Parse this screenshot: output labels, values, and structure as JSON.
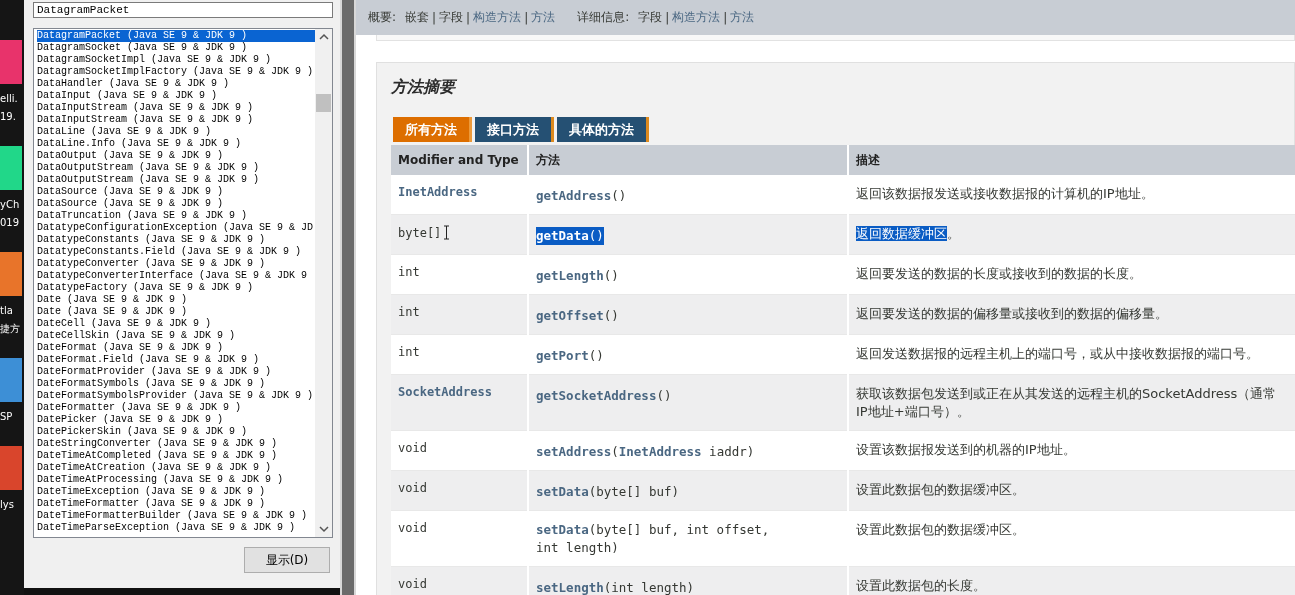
{
  "desktop_icons": [
    {
      "color": "#e8336b",
      "labels": [
        "elli.",
        "19."
      ]
    },
    {
      "color": "#21d789",
      "labels": [
        "yCh",
        "019"
      ]
    },
    {
      "color": "#e8742a",
      "labels": [
        "tla",
        "捷方"
      ]
    },
    {
      "color": "#3d8fd6",
      "labels": [
        "SP"
      ]
    },
    {
      "color": "#d9452c",
      "labels": [
        "lys"
      ]
    }
  ],
  "index_panel": {
    "search": {
      "value": "DatagramPacket"
    },
    "items": [
      {
        "text": "DatagramPacket (Java SE 9 & JDK 9 )",
        "selected": true
      },
      {
        "text": "DatagramSocket (Java SE 9 & JDK 9 )",
        "selected": false
      },
      {
        "text": "DatagramSocketImpl (Java SE 9 & JDK 9 )",
        "selected": false
      },
      {
        "text": "DatagramSocketImplFactory (Java SE 9 & JDK 9 )",
        "selected": false
      },
      {
        "text": "DataHandler (Java SE 9 & JDK 9 )",
        "selected": false
      },
      {
        "text": "DataInput (Java SE 9 & JDK 9 )",
        "selected": false
      },
      {
        "text": "DataInputStream (Java SE 9 & JDK 9 )",
        "selected": false
      },
      {
        "text": "DataInputStream (Java SE 9 & JDK 9 )",
        "selected": false
      },
      {
        "text": "DataLine (Java SE 9 & JDK 9 )",
        "selected": false
      },
      {
        "text": "DataLine.Info (Java SE 9 & JDK 9 )",
        "selected": false
      },
      {
        "text": "DataOutput (Java SE 9 & JDK 9 )",
        "selected": false
      },
      {
        "text": "DataOutputStream (Java SE 9 & JDK 9 )",
        "selected": false
      },
      {
        "text": "DataOutputStream (Java SE 9 & JDK 9 )",
        "selected": false
      },
      {
        "text": "DataSource (Java SE 9 & JDK 9 )",
        "selected": false
      },
      {
        "text": "DataSource (Java SE 9 & JDK 9 )",
        "selected": false
      },
      {
        "text": "DataTruncation (Java SE 9 & JDK 9 )",
        "selected": false
      },
      {
        "text": "DatatypeConfigurationException (Java SE 9 & JD",
        "selected": false
      },
      {
        "text": "DatatypeConstants (Java SE 9 & JDK 9 )",
        "selected": false
      },
      {
        "text": "DatatypeConstants.Field (Java SE 9 & JDK 9 )",
        "selected": false
      },
      {
        "text": "DatatypeConverter (Java SE 9 & JDK 9 )",
        "selected": false
      },
      {
        "text": "DatatypeConverterInterface (Java SE 9 & JDK 9",
        "selected": false
      },
      {
        "text": "DatatypeFactory (Java SE 9 & JDK 9 )",
        "selected": false
      },
      {
        "text": "Date (Java SE 9 & JDK 9 )",
        "selected": false
      },
      {
        "text": "Date (Java SE 9 & JDK 9 )",
        "selected": false
      },
      {
        "text": "DateCell (Java SE 9 & JDK 9 )",
        "selected": false
      },
      {
        "text": "DateCellSkin (Java SE 9 & JDK 9 )",
        "selected": false
      },
      {
        "text": "DateFormat (Java SE 9 & JDK 9 )",
        "selected": false
      },
      {
        "text": "DateFormat.Field (Java SE 9 & JDK 9 )",
        "selected": false
      },
      {
        "text": "DateFormatProvider (Java SE 9 & JDK 9 )",
        "selected": false
      },
      {
        "text": "DateFormatSymbols (Java SE 9 & JDK 9 )",
        "selected": false
      },
      {
        "text": "DateFormatSymbolsProvider (Java SE 9 & JDK 9 )",
        "selected": false
      },
      {
        "text": "DateFormatter (Java SE 9 & JDK 9 )",
        "selected": false
      },
      {
        "text": "DatePicker (Java SE 9 & JDK 9 )",
        "selected": false
      },
      {
        "text": "DatePickerSkin (Java SE 9 & JDK 9 )",
        "selected": false
      },
      {
        "text": "DateStringConverter (Java SE 9 & JDK 9 )",
        "selected": false
      },
      {
        "text": "DateTimeAtCompleted (Java SE 9 & JDK 9 )",
        "selected": false
      },
      {
        "text": "DateTimeAtCreation (Java SE 9 & JDK 9 )",
        "selected": false
      },
      {
        "text": "DateTimeAtProcessing (Java SE 9 & JDK 9 )",
        "selected": false
      },
      {
        "text": "DateTimeException (Java SE 9 & JDK 9 )",
        "selected": false
      },
      {
        "text": "DateTimeFormatter (Java SE 9 & JDK 9 )",
        "selected": false
      },
      {
        "text": "DateTimeFormatterBuilder (Java SE 9 & JDK 9 )",
        "selected": false
      },
      {
        "text": "DateTimeParseException (Java SE 9 & JDK 9 )",
        "selected": false
      }
    ],
    "display_button": "显示(D)"
  },
  "subnav": [
    {
      "label": "概要:",
      "items": [
        {
          "text": "嵌套",
          "kind": "plain"
        },
        {
          "text": "|",
          "kind": "separator"
        },
        {
          "text": "字段",
          "kind": "plain"
        },
        {
          "text": "|",
          "kind": "separator"
        },
        {
          "text": "构造方法",
          "kind": "link"
        },
        {
          "text": "|",
          "kind": "separator"
        },
        {
          "text": "方法",
          "kind": "link"
        }
      ]
    },
    {
      "label": "详细信息:",
      "items": [
        {
          "text": "字段",
          "kind": "plain"
        },
        {
          "text": "|",
          "kind": "separator"
        },
        {
          "text": "构造方法",
          "kind": "link"
        },
        {
          "text": "|",
          "kind": "separator"
        },
        {
          "text": "方法",
          "kind": "link"
        }
      ]
    }
  ],
  "method_summary": {
    "title": "方法摘要",
    "tabs": [
      {
        "label": "所有方法",
        "selected": true
      },
      {
        "label": "接口方法",
        "selected": false
      },
      {
        "label": "具体的方法",
        "selected": false
      }
    ],
    "columns": [
      "Modifier and Type",
      "方法",
      "描述"
    ],
    "rows": [
      {
        "type": "InetAddress",
        "type_link": true,
        "method": "**getAddress**()",
        "method_selected": false,
        "cursor": false,
        "desc": [
          [
            {
              "text": "返回该数据报发送或接收数据报的计算机的IP地址。",
              "selected": false
            }
          ]
        ]
      },
      {
        "type": "byte[]",
        "type_link": false,
        "method": "**getData**()",
        "method_selected": true,
        "cursor": true,
        "desc": [
          [
            {
              "text": "返回数据缓冲区",
              "selected": true
            },
            {
              "text": "。",
              "selected": false
            }
          ]
        ]
      },
      {
        "type": "int",
        "type_link": false,
        "method": "**getLength**()",
        "method_selected": false,
        "cursor": false,
        "desc": [
          [
            {
              "text": "返回要发送的数据的长度或接收到的数据的长度。",
              "selected": false
            }
          ]
        ]
      },
      {
        "type": "int",
        "type_link": false,
        "method": "**getOffset**()",
        "method_selected": false,
        "cursor": false,
        "desc": [
          [
            {
              "text": "返回要发送的数据的偏移量或接收到的数据的偏移量。",
              "selected": false
            }
          ]
        ]
      },
      {
        "type": "int",
        "type_link": false,
        "method": "**getPort**()",
        "method_selected": false,
        "cursor": false,
        "desc": [
          [
            {
              "text": "返回发送数据报的远程主机上的端口号，或从中接收数据报的端口号。",
              "selected": false
            }
          ]
        ]
      },
      {
        "type": "SocketAddress",
        "type_link": true,
        "method": "**getSocketAddress**()",
        "method_selected": false,
        "cursor": false,
        "desc": [
          [
            {
              "text": "获取该数据包发送到或正在从其发送的远程主机的SocketAddress（通常",
              "selected": false
            }
          ],
          [
            {
              "text": "IP地址+端口号）。",
              "selected": false
            }
          ]
        ]
      },
      {
        "type": "void",
        "type_link": false,
        "method": "**setAddress**(**InetAddress** iaddr)",
        "method_selected": false,
        "cursor": false,
        "desc": [
          [
            {
              "text": "设置该数据报发送到的机器的IP地址。",
              "selected": false
            }
          ]
        ]
      },
      {
        "type": "void",
        "type_link": false,
        "method": "**setData**(byte[] buf)",
        "method_selected": false,
        "cursor": false,
        "desc": [
          [
            {
              "text": "设置此数据包的数据缓冲区。",
              "selected": false
            }
          ]
        ]
      },
      {
        "type": "void",
        "type_link": false,
        "method": "**setData**(byte[] buf, int offset,\nint length)",
        "method_selected": false,
        "cursor": false,
        "desc": [
          [
            {
              "text": "设置此数据包的数据缓冲区。",
              "selected": false
            }
          ]
        ]
      },
      {
        "type": "void",
        "type_link": false,
        "method": "**setLength**(int length)",
        "method_selected": false,
        "cursor": false,
        "desc": [
          [
            {
              "text": "设置此数据包的长度。",
              "selected": false
            }
          ]
        ]
      }
    ]
  }
}
